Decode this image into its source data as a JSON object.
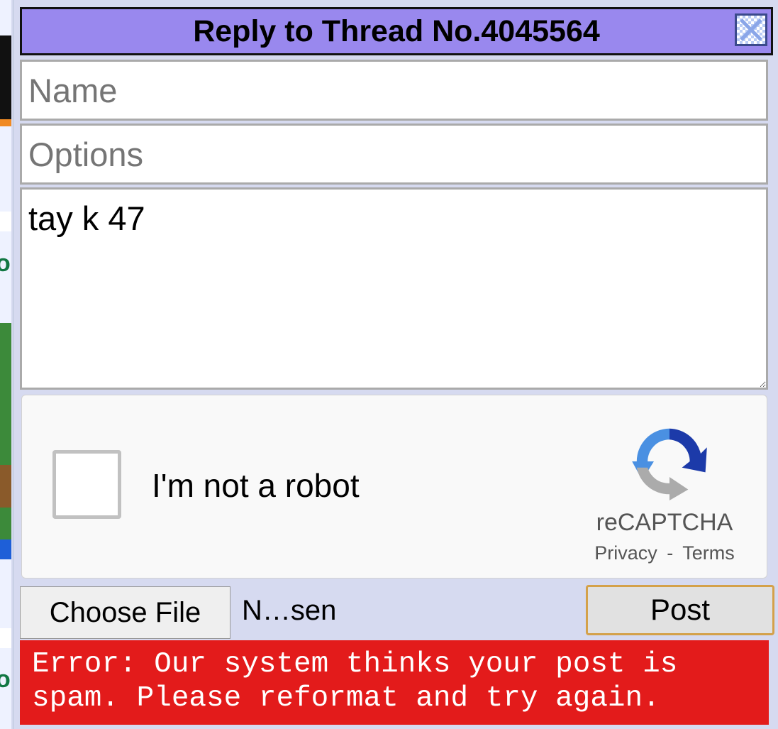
{
  "form": {
    "title": "Reply to Thread No.4045564",
    "name_placeholder": "Name",
    "options_placeholder": "Options",
    "comment_value": "tay k 47",
    "captcha": {
      "label": "I'm not a robot",
      "brand": "reCAPTCHA",
      "privacy": "Privacy",
      "separator": "-",
      "terms": "Terms"
    },
    "file_button": "Choose File",
    "file_name": "N…sen",
    "post_button": "Post",
    "error": "Error: Our system thinks your post is spam. Please reformat and try again."
  },
  "colors": {
    "titlebar": "#9988ee",
    "error_bg": "#e31b1b",
    "post_border": "#d4a14a",
    "panel_bg": "#d6daf0"
  },
  "icons": {
    "close": "close-icon",
    "captcha_logo": "recaptcha-logo-icon"
  }
}
